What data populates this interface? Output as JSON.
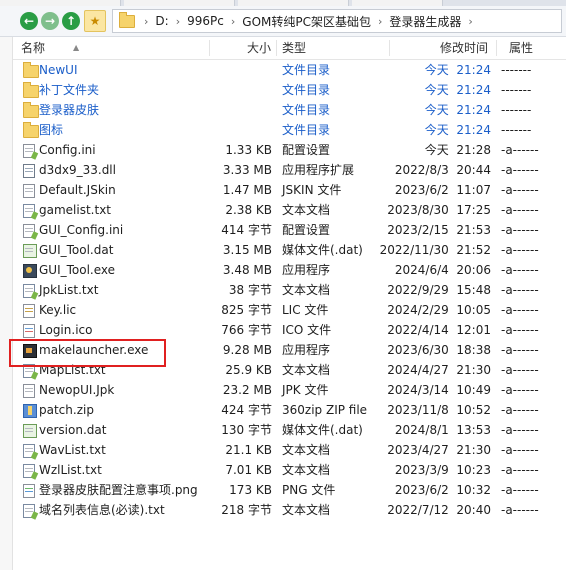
{
  "address": {
    "crumbs": [
      "D:",
      "996Pc",
      "GOM转纯PC架区基础包",
      "登录器生成器"
    ]
  },
  "columns": {
    "name": "名称",
    "size": "大小",
    "type": "类型",
    "modified": "修改时间",
    "attr": "属性"
  },
  "files": [
    {
      "name": "NewUI",
      "size": "",
      "type": "文件目录",
      "date": "今天",
      "time": "21:24",
      "attr": "-------",
      "icon": "folder-icon",
      "dir": true
    },
    {
      "name": "补丁文件夹",
      "size": "",
      "type": "文件目录",
      "date": "今天",
      "time": "21:24",
      "attr": "-------",
      "icon": "folder-icon",
      "dir": true
    },
    {
      "name": "登录器皮肤",
      "size": "",
      "type": "文件目录",
      "date": "今天",
      "time": "21:24",
      "attr": "-------",
      "icon": "folder-icon",
      "dir": true
    },
    {
      "name": "图标",
      "size": "",
      "type": "文件目录",
      "date": "今天",
      "time": "21:24",
      "attr": "-------",
      "icon": "folder-icon",
      "dir": true
    },
    {
      "name": "Config.ini",
      "size": "1.33 KB",
      "type": "配置设置",
      "date": "今天",
      "time": "21:28",
      "attr": "-a------",
      "icon": "config-file-icon",
      "cls": "cfg"
    },
    {
      "name": "d3dx9_33.dll",
      "size": "3.33 MB",
      "type": "应用程序扩展",
      "date": "2022/8/3",
      "time": "20:44",
      "attr": "-a------",
      "icon": "dll-file-icon",
      "cls": "dll"
    },
    {
      "name": "Default.JSkin",
      "size": "1.47 MB",
      "type": "JSKIN 文件",
      "date": "2023/6/2",
      "time": "11:07",
      "attr": "-a------",
      "icon": "file-icon",
      "cls": ""
    },
    {
      "name": "gamelist.txt",
      "size": "2.38 KB",
      "type": "文本文档",
      "date": "2023/8/30",
      "time": "17:25",
      "attr": "-a------",
      "icon": "text-file-icon",
      "cls": "txt cfg"
    },
    {
      "name": "GUI_Config.ini",
      "size": "414 字节",
      "type": "配置设置",
      "date": "2023/2/15",
      "time": "21:53",
      "attr": "-a------",
      "icon": "config-file-icon",
      "cls": "cfg"
    },
    {
      "name": "GUI_Tool.dat",
      "size": "3.15 MB",
      "type": "媒体文件(.dat)",
      "date": "2022/11/30",
      "time": "21:52",
      "attr": "-a------",
      "icon": "dat-file-icon",
      "cls": "dat"
    },
    {
      "name": "GUI_Tool.exe",
      "size": "3.48 MB",
      "type": "应用程序",
      "date": "2024/6/4",
      "time": "20:06",
      "attr": "-a------",
      "icon": "app-icon",
      "cls": "exe-gui"
    },
    {
      "name": "JpkList.txt",
      "size": "38 字节",
      "type": "文本文档",
      "date": "2022/9/29",
      "time": "15:48",
      "attr": "-a------",
      "icon": "text-file-icon",
      "cls": "txt cfg"
    },
    {
      "name": "Key.lic",
      "size": "825 字节",
      "type": "LIC 文件",
      "date": "2024/2/29",
      "time": "10:05",
      "attr": "-a------",
      "icon": "license-file-icon",
      "cls": "lic"
    },
    {
      "name": "Login.ico",
      "size": "766 字节",
      "type": "ICO 文件",
      "date": "2022/4/14",
      "time": "12:01",
      "attr": "-a------",
      "icon": "ico-file-icon",
      "cls": "ico"
    },
    {
      "name": "makelauncher.exe",
      "size": "9.28 MB",
      "type": "应用程序",
      "date": "2023/6/30",
      "time": "18:38",
      "attr": "-a------",
      "icon": "app-icon",
      "cls": "exe-mk"
    },
    {
      "name": "MapList.txt",
      "size": "25.9 KB",
      "type": "文本文档",
      "date": "2024/4/27",
      "time": "21:30",
      "attr": "-a------",
      "icon": "text-file-icon",
      "cls": "txt cfg"
    },
    {
      "name": "NewopUI.Jpk",
      "size": "23.2 MB",
      "type": "JPK 文件",
      "date": "2024/3/14",
      "time": "10:49",
      "attr": "-a------",
      "icon": "file-icon",
      "cls": ""
    },
    {
      "name": "patch.zip",
      "size": "424 字节",
      "type": "360zip ZIP file",
      "date": "2023/11/8",
      "time": "10:52",
      "attr": "-a------",
      "icon": "zip-file-icon",
      "cls": "zip"
    },
    {
      "name": "version.dat",
      "size": "130 字节",
      "type": "媒体文件(.dat)",
      "date": "2024/8/1",
      "time": "13:53",
      "attr": "-a------",
      "icon": "dat-file-icon",
      "cls": "dat"
    },
    {
      "name": "WavList.txt",
      "size": "21.1 KB",
      "type": "文本文档",
      "date": "2023/4/27",
      "time": "21:30",
      "attr": "-a------",
      "icon": "text-file-icon",
      "cls": "txt cfg"
    },
    {
      "name": "WzlList.txt",
      "size": "7.01 KB",
      "type": "文本文档",
      "date": "2023/3/9",
      "time": "10:23",
      "attr": "-a------",
      "icon": "text-file-icon",
      "cls": "txt cfg"
    },
    {
      "name": "登录器皮肤配置注意事项.png",
      "size": "173 KB",
      "type": "PNG 文件",
      "date": "2023/6/2",
      "time": "10:32",
      "attr": "-a------",
      "icon": "image-file-icon",
      "cls": "png"
    },
    {
      "name": "域名列表信息(必读).txt",
      "size": "218 字节",
      "type": "文本文档",
      "date": "2022/7/12",
      "time": "20:40",
      "attr": "-a------",
      "icon": "text-file-icon",
      "cls": "txt cfg"
    }
  ],
  "colors": {
    "dir_text": "#1b5ec9",
    "highlight": "#e02020"
  }
}
